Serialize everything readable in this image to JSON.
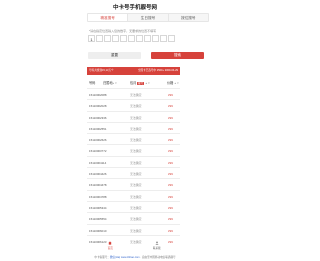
{
  "page": {
    "title": "中卡号手机靓号网"
  },
  "tabs": [
    {
      "label": "精准搜号",
      "active": true
    },
    {
      "label": "生日搜号",
      "active": false
    },
    {
      "label": "按位搜号",
      "active": false
    }
  ],
  "search": {
    "hint": "*请在指定位置输入您的数字，无要求的位置不填写",
    "digits": [
      "1",
      "",
      "",
      "",
      "",
      "",
      "",
      "",
      "",
      "",
      ""
    ],
    "reset_label": "重置",
    "submit_label": "搜索"
  },
  "banner": {
    "left": "号码共找到15,13万个",
    "right": "全国卡已选号中 1500+ 2009-04-29"
  },
  "table": {
    "headers": {
      "number": "号码",
      "category": "归属地",
      "sort1": "▲▼",
      "fee": "包月",
      "badge": "靓号",
      "sort2": "▲▼",
      "price": "价格",
      "sort3": "▲▼"
    },
    "rows": [
      {
        "number": "15110002088",
        "state": "无法确定",
        "price": "¥99"
      },
      {
        "number": "15110002028",
        "state": "无法确定",
        "price": "¥99"
      },
      {
        "number": "15110002336",
        "state": "无法确定",
        "price": "¥99"
      },
      {
        "number": "15110002551",
        "state": "无法确定",
        "price": "¥99"
      },
      {
        "number": "15110002626",
        "state": "无法确定",
        "price": "¥99"
      },
      {
        "number": "15110003772",
        "state": "无法确定",
        "price": "¥99"
      },
      {
        "number": "15110004114",
        "state": "无法确定",
        "price": "¥99"
      },
      {
        "number": "15110004426",
        "state": "无法确定",
        "price": "¥99"
      },
      {
        "number": "15110004478",
        "state": "无法确定",
        "price": "¥99"
      },
      {
        "number": "15110004788",
        "state": "无法确定",
        "price": "¥99"
      },
      {
        "number": "15110005344",
        "state": "无法确定",
        "price": "¥99"
      },
      {
        "number": "15110005554",
        "state": "无法确定",
        "price": "¥99"
      },
      {
        "number": "15110006010",
        "state": "无法确定",
        "price": "¥99"
      },
      {
        "number": "15110006123",
        "state": "无法确定",
        "price": "¥99"
      }
    ]
  },
  "nav": {
    "home_label": "首页",
    "user_label": "联系我"
  },
  "footer": {
    "prefix": "中卡客服号：",
    "link": "微信(Ha) www.zkhao.com",
    "suffix": " · 自由型中国移动电信联通靓号"
  },
  "colors": {
    "accent": "#d6423b"
  }
}
